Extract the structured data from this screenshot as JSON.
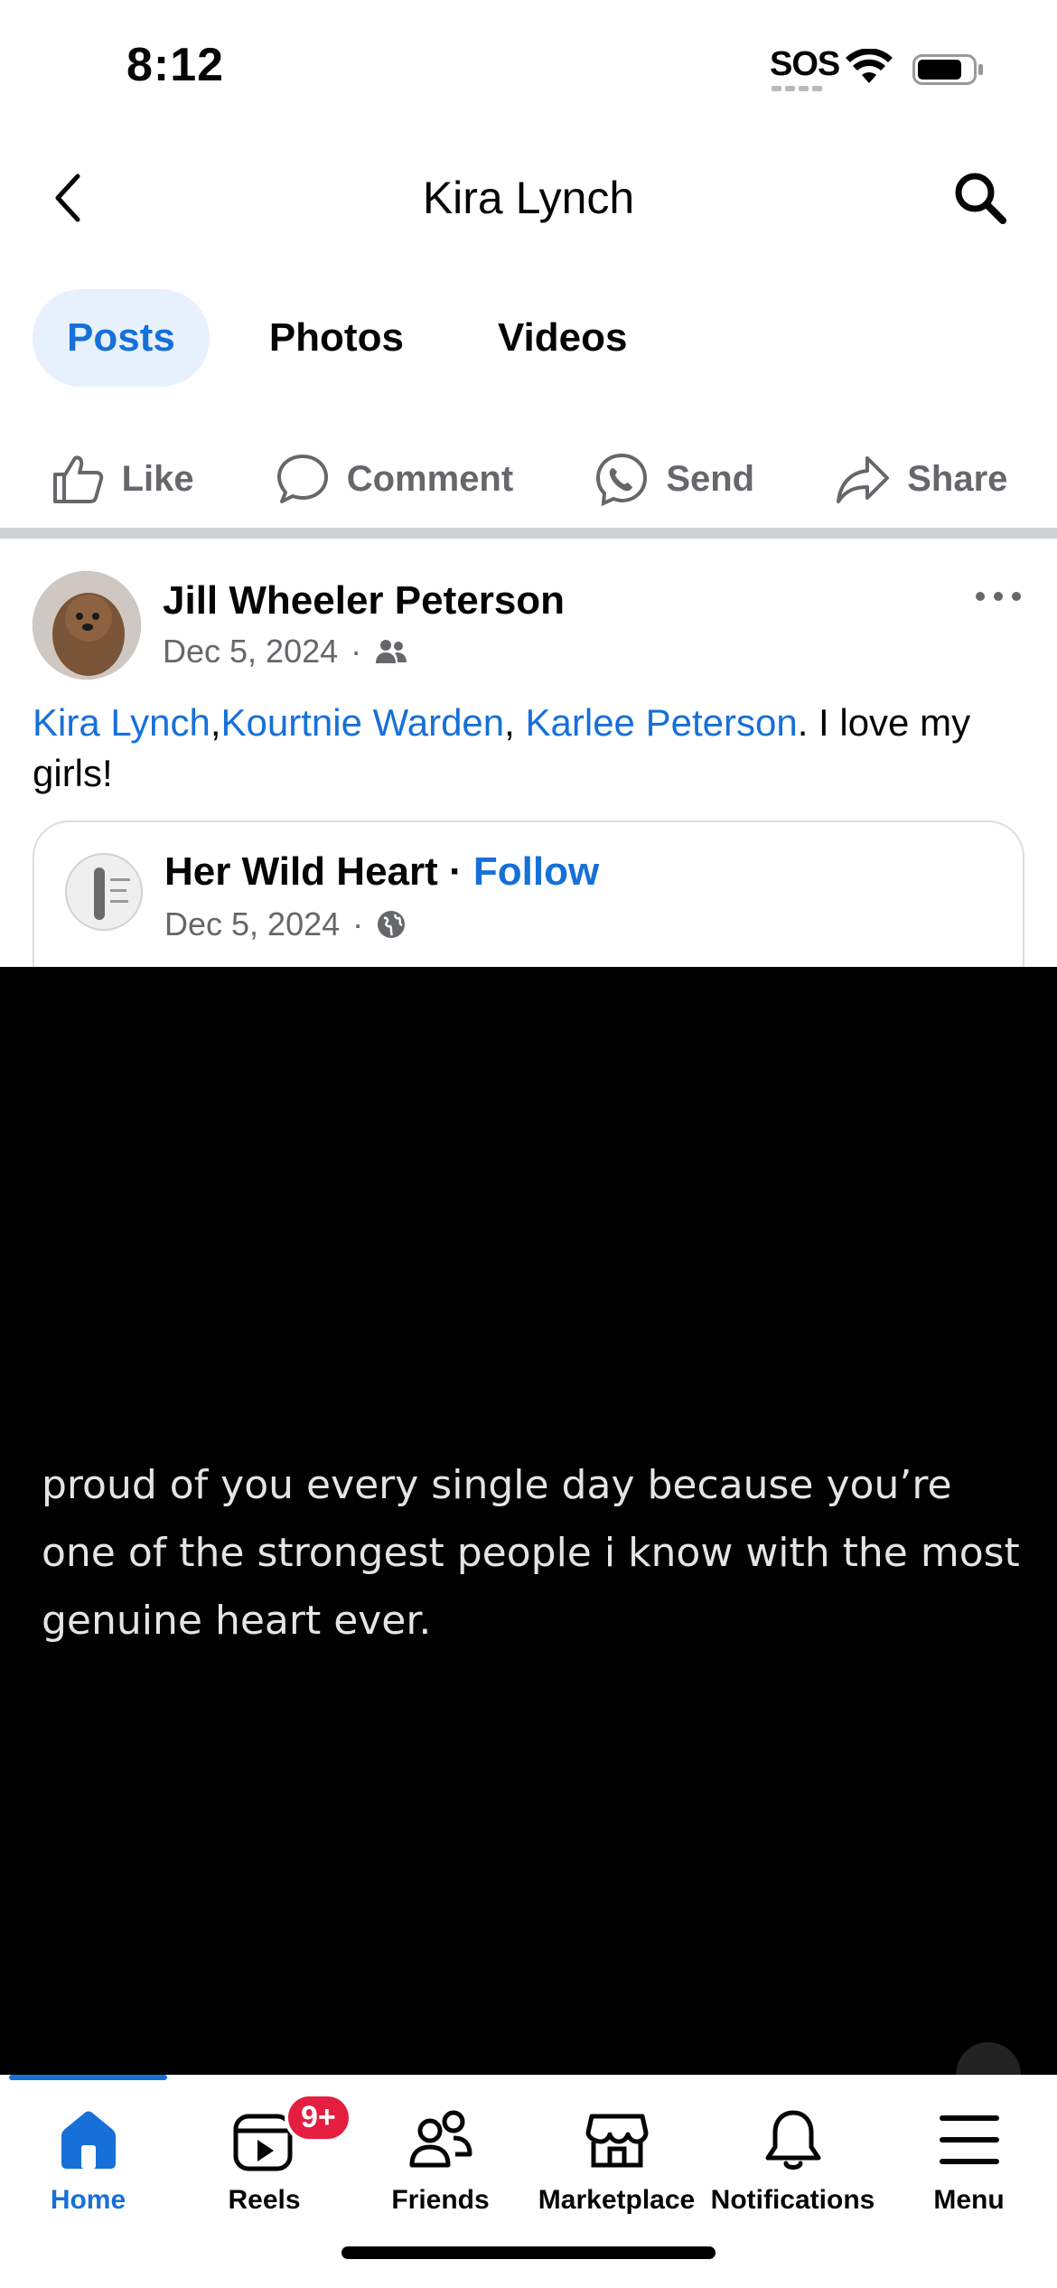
{
  "status_bar": {
    "time": "8:12",
    "sos": "SOS",
    "icons": [
      "wifi-icon",
      "battery-icon"
    ]
  },
  "header": {
    "title": "Kira Lynch",
    "icons": [
      "back-chevron-icon",
      "search-icon"
    ]
  },
  "tabs": [
    {
      "label": "Posts",
      "active": true
    },
    {
      "label": "Photos",
      "active": false
    },
    {
      "label": "Videos",
      "active": false
    }
  ],
  "actions": [
    {
      "label": "Like",
      "icon": "thumbs-up-icon"
    },
    {
      "label": "Comment",
      "icon": "comment-icon"
    },
    {
      "label": "Send",
      "icon": "messenger-icon"
    },
    {
      "label": "Share",
      "icon": "share-arrow-icon"
    }
  ],
  "post": {
    "author": "Jill Wheeler Peterson",
    "date": "Dec 5, 2024",
    "separator": "·",
    "audience_icon": "friends-icon",
    "mentions": [
      "Kira Lynch",
      "Kourtnie Warden",
      "Karlee Peterson"
    ],
    "mention_sep_1": ",",
    "mention_sep_2": ", ",
    "text_suffix": ". I love my girls!",
    "shared": {
      "name": "Her Wild Heart",
      "dot": " · ",
      "follow": "Follow",
      "date": "Dec 5, 2024",
      "separator": "·",
      "audience_icon": "globe-icon"
    },
    "video_caption": "proud of you every single day because you’re one of the strongest people i know with the most genuine heart ever."
  },
  "bottom_nav": [
    {
      "label": "Home",
      "icon": "home-icon",
      "active": true
    },
    {
      "label": "Reels",
      "icon": "reels-icon",
      "badge": "9+"
    },
    {
      "label": "Friends",
      "icon": "friends-icon"
    },
    {
      "label": "Marketplace",
      "icon": "marketplace-icon"
    },
    {
      "label": "Notifications",
      "icon": "bell-icon"
    },
    {
      "label": "Menu",
      "icon": "menu-icon"
    }
  ],
  "colors": {
    "accent": "#1670d8",
    "tab_active_bg": "#e7f1fd",
    "muted": "#65676b",
    "badge": "#e41e3f"
  }
}
